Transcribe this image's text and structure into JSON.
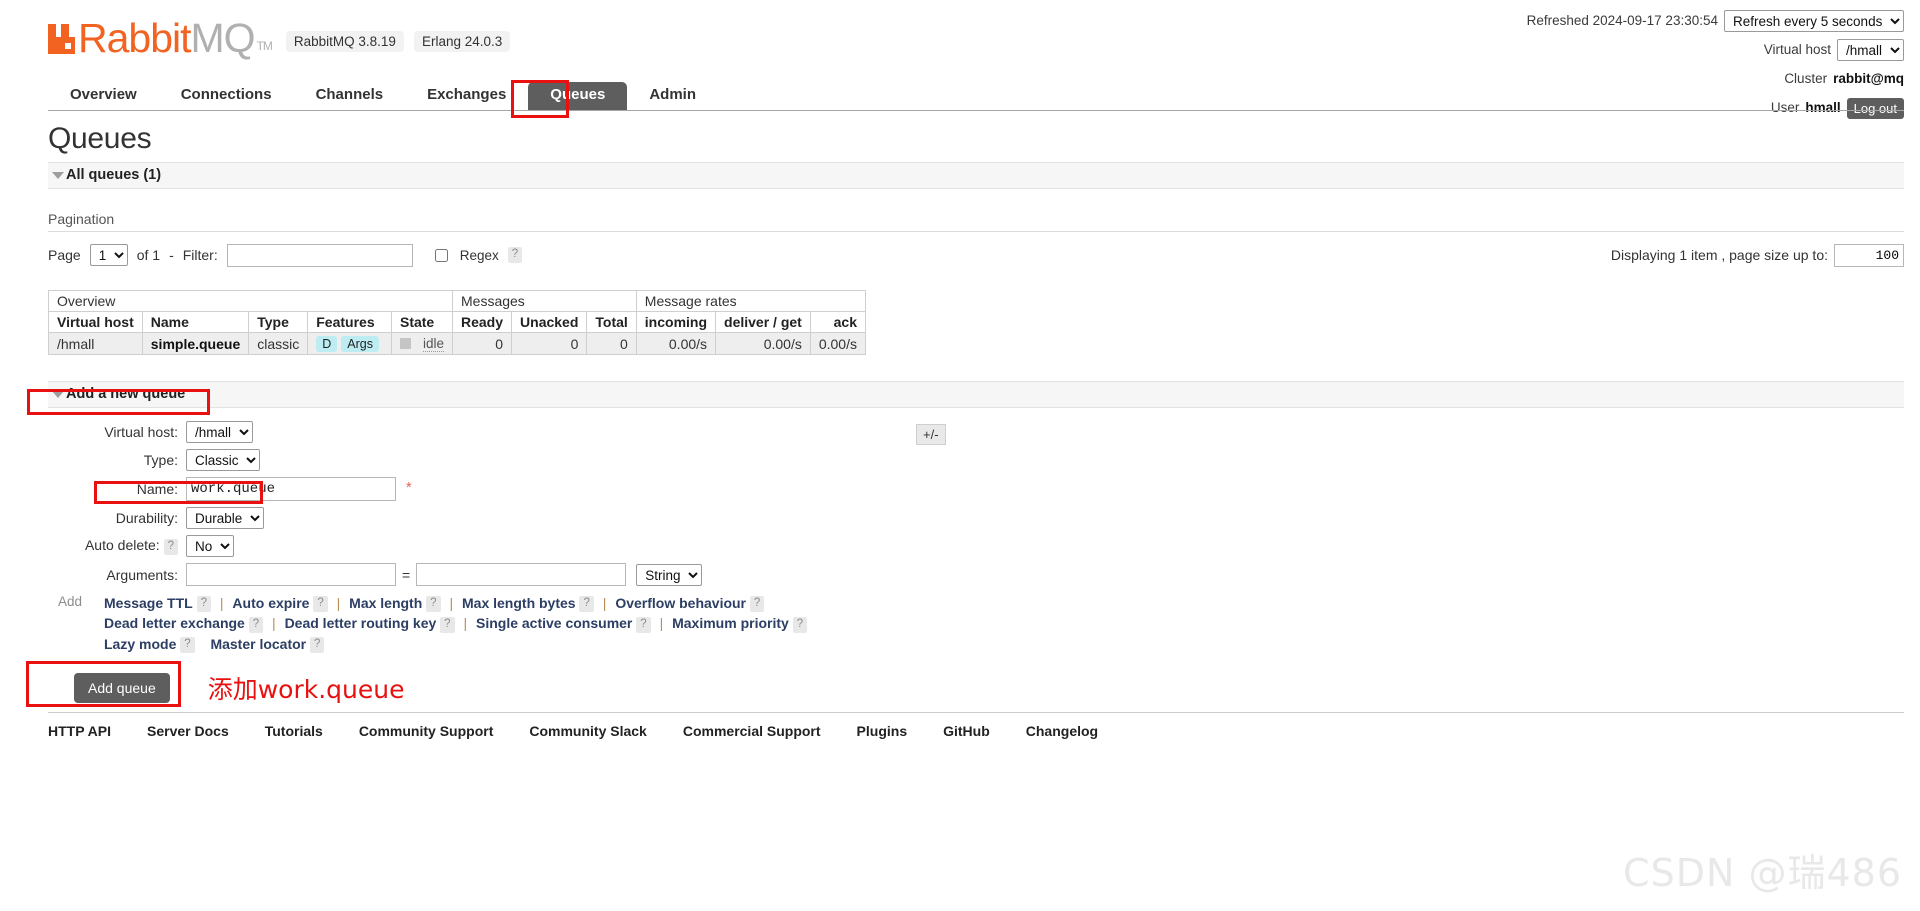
{
  "header": {
    "logo_rabbit": "Rabbit",
    "logo_mq": "MQ",
    "logo_tm": "TM",
    "versions": [
      "RabbitMQ 3.8.19",
      "Erlang 24.0.3"
    ],
    "refreshed_label": "Refreshed 2024-09-17 23:30:54",
    "refresh_select": "Refresh every 5 seconds",
    "vhost_label": "Virtual host",
    "vhost_select": "/hmall",
    "cluster_label": "Cluster",
    "cluster_value": "rabbit@mq",
    "user_label": "User",
    "user_value": "hmall",
    "logout_label": "Log out"
  },
  "nav": {
    "tabs": [
      {
        "label": "Overview",
        "active": false
      },
      {
        "label": "Connections",
        "active": false
      },
      {
        "label": "Channels",
        "active": false
      },
      {
        "label": "Exchanges",
        "active": false
      },
      {
        "label": "Queues",
        "active": true
      },
      {
        "label": "Admin",
        "active": false
      }
    ]
  },
  "main": {
    "page_title": "Queues",
    "all_queues_header": "All queues (1)",
    "pagination_label": "Pagination",
    "page_label": "Page",
    "page_value": "1",
    "of_label": "of 1",
    "dash": "-",
    "filter_label": "Filter:",
    "filter_value": "",
    "regex_label": "Regex",
    "regex_help": "?",
    "displaying_label": "Displaying 1 item , page size up to:",
    "page_size_value": "100"
  },
  "queues_table": {
    "group_headers": [
      {
        "label": "Overview",
        "span": 5
      },
      {
        "label": "Messages",
        "span": 3
      },
      {
        "label": "Message rates",
        "span": 3
      }
    ],
    "plus_minus": "+/-",
    "columns": [
      {
        "label": "Virtual host",
        "align": "left"
      },
      {
        "label": "Name",
        "align": "left"
      },
      {
        "label": "Type",
        "align": "left"
      },
      {
        "label": "Features",
        "align": "left"
      },
      {
        "label": "State",
        "align": "left"
      },
      {
        "label": "Ready",
        "align": "right"
      },
      {
        "label": "Unacked",
        "align": "right"
      },
      {
        "label": "Total",
        "align": "right"
      },
      {
        "label": "incoming",
        "align": "right"
      },
      {
        "label": "deliver / get",
        "align": "right"
      },
      {
        "label": "ack",
        "align": "right"
      }
    ],
    "rows": [
      {
        "vhost": "/hmall",
        "name": "simple.queue",
        "type": "classic",
        "features": [
          "D",
          "Args"
        ],
        "state": "idle",
        "ready": "0",
        "unacked": "0",
        "total": "0",
        "incoming": "0.00/s",
        "deliver_get": "0.00/s",
        "ack": "0.00/s"
      }
    ]
  },
  "add_queue": {
    "section_title": "Add a new queue",
    "fields": {
      "vhost_label": "Virtual host:",
      "vhost_value": "/hmall",
      "type_label": "Type:",
      "type_value": "Classic",
      "name_label": "Name:",
      "name_value": "work.queue",
      "name_required": "*",
      "durability_label": "Durability:",
      "durability_value": "Durable",
      "autodelete_label": "Auto delete:",
      "autodelete_help": "?",
      "autodelete_value": "No",
      "arguments_label": "Arguments:",
      "arg_key_value": "",
      "arg_equals": "=",
      "arg_val_value": "",
      "arg_type_value": "String"
    },
    "add_label": "Add",
    "presets_row1": [
      "Message TTL",
      "Auto expire",
      "Max length",
      "Max length bytes",
      "Overflow behaviour"
    ],
    "presets_row2": [
      "Dead letter exchange",
      "Dead letter routing key",
      "Single active consumer",
      "Maximum priority"
    ],
    "presets_row3": [
      "Lazy mode",
      "Master locator"
    ],
    "help_mark": "?",
    "separator": "|",
    "submit_label": "Add queue",
    "annotation": "添加work.queue"
  },
  "footer": {
    "links": [
      "HTTP API",
      "Server Docs",
      "Tutorials",
      "Community Support",
      "Community Slack",
      "Commercial Support",
      "Plugins",
      "GitHub",
      "Changelog"
    ]
  },
  "watermark": "CSDN @瑞486",
  "colors": {
    "brand_orange": "#f26322",
    "tab_active_bg": "#5e5e5e",
    "annotation_red": "#e8110f",
    "feature_tag_bg": "#bdecf3"
  }
}
